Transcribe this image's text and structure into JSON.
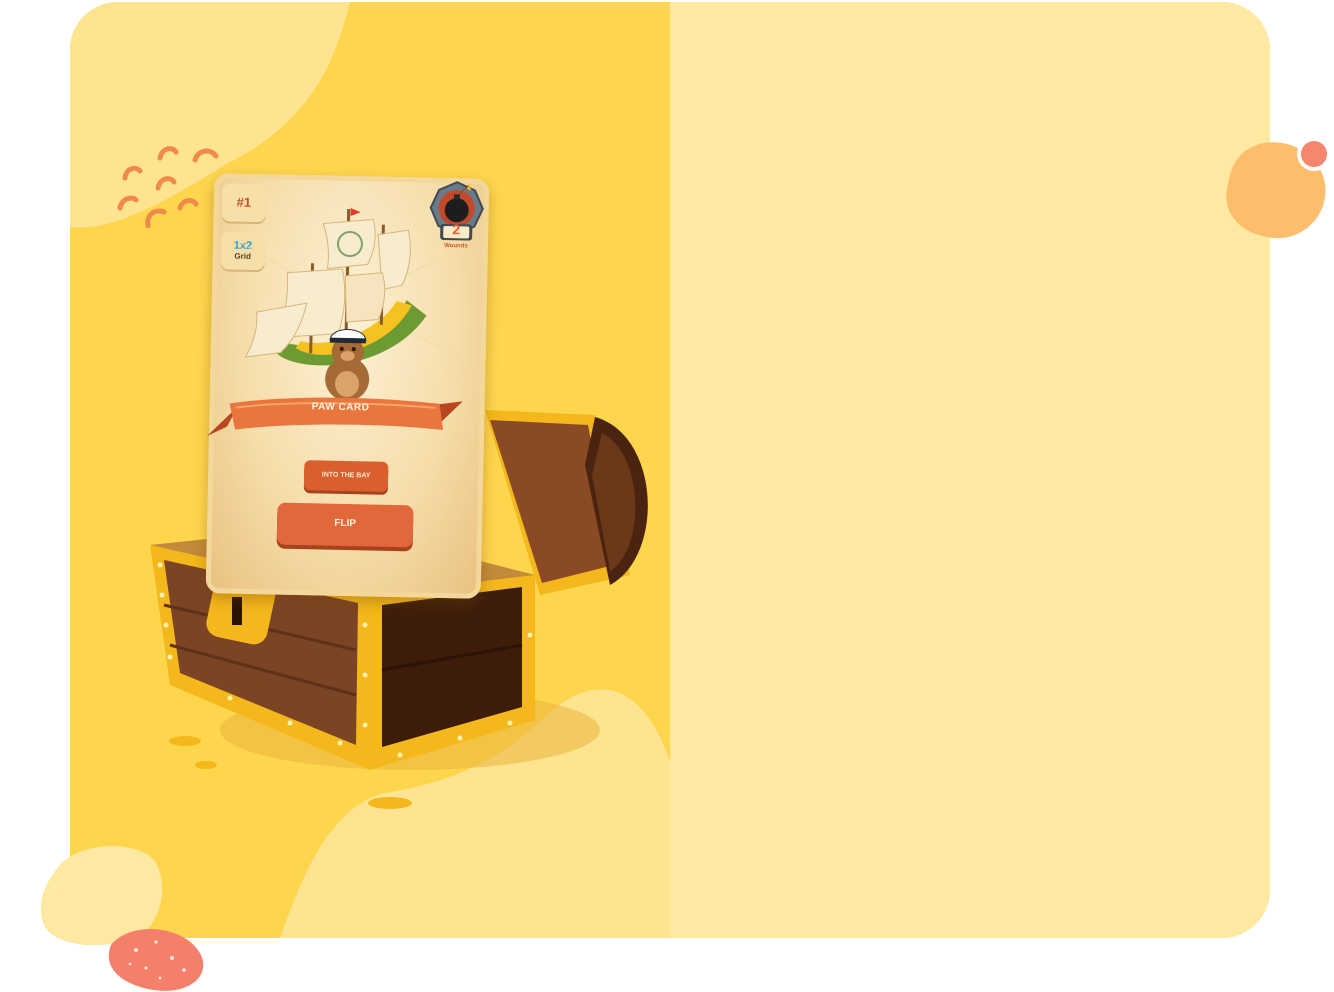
{
  "card": {
    "number": "#1",
    "grid_value": "1x2",
    "grid_label": "Grid",
    "wounds_value": "2",
    "wounds_label": "Wounds",
    "title": "PAW CARD",
    "secondary_action": "INTO THE BAY",
    "primary_action": "FLIP"
  },
  "colors": {
    "left_background": "#fed64e",
    "right_background": "#fee9a2",
    "accent_orange": "#e0683a",
    "chest_wood": "#7a4425",
    "chest_gold": "#f4b81c"
  }
}
